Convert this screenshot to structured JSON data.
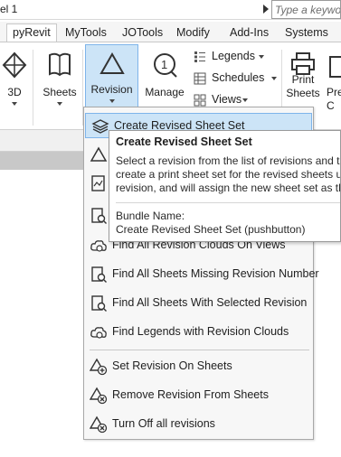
{
  "window": {
    "title": "el 1",
    "search_placeholder": "Type a keyword"
  },
  "tabs": [
    {
      "label": "pyRevit",
      "active": true
    },
    {
      "label": "MyTools"
    },
    {
      "label": "JOTools"
    },
    {
      "label": "Modify"
    },
    {
      "label": "Add-Ins"
    },
    {
      "label": "Systems"
    }
  ],
  "ribbon": {
    "buttons": {
      "3d": "3D",
      "sheets": "Sheets",
      "revision": "Revision",
      "manage": "Manage",
      "print_sheets_1": "Print",
      "print_sheets_2": "Sheets",
      "pre_1": "Pre",
      "pre_2": "C"
    },
    "small": {
      "legends": "Legends",
      "schedules": "Schedules",
      "views": "Views"
    }
  },
  "dropdown": {
    "items": [
      {
        "label": "Create Revised Sheet Set",
        "icon": "layers-icon",
        "highlighted": true
      },
      {
        "label": "Find All Revision Clouds On Views",
        "icon": "cloud-icon"
      },
      {
        "label": "Find All Sheets Missing Revision Number",
        "icon": "sheet-search-icon"
      },
      {
        "label": "Find All Sheets With Selected Revision",
        "icon": "sheet-search-icon"
      },
      {
        "label": "Find Legends with Revision Clouds",
        "icon": "cloud-icon"
      },
      {
        "label": "Set Revision On Sheets",
        "icon": "triangle-plus-icon"
      },
      {
        "label": "Remove Revision From Sheets",
        "icon": "triangle-x-icon"
      },
      {
        "label": "Turn Off all revisions",
        "icon": "triangle-x-icon"
      }
    ]
  },
  "tooltip": {
    "title": "Create Revised Sheet Set",
    "desc_line1": "Select a revision from the list of revisions and th",
    "desc_line2": "create a print sheet set for the revised sheets un",
    "desc_line3": "revision, and will assign the new sheet set as the",
    "bundle_label": "Bundle Name:",
    "bundle_value": "Create Revised Sheet Set (pushbutton)"
  },
  "colors": {
    "highlight": "#cce4f7",
    "highlight_border": "#7eb4ea"
  }
}
